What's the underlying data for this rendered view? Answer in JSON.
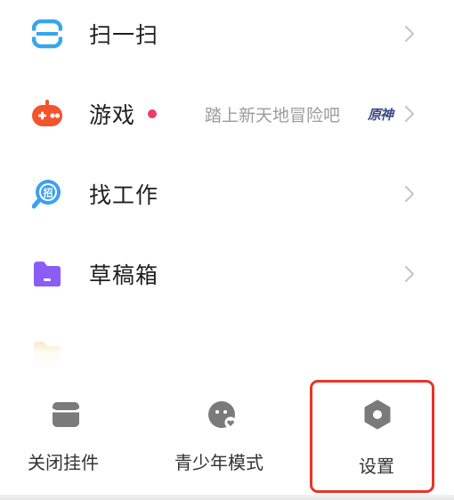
{
  "menu": {
    "items": [
      {
        "label": "扫一扫",
        "icon": "scan-icon"
      },
      {
        "label": "游戏",
        "icon": "gamepad-icon",
        "subtitle": "踏上新天地冒险吧",
        "badge": "原神",
        "has_dot": true
      },
      {
        "label": "找工作",
        "icon": "job-search-icon"
      },
      {
        "label": "草稿箱",
        "icon": "folder-icon"
      },
      {
        "label": "",
        "icon": "folder-icon",
        "partially_visible": true
      }
    ]
  },
  "bottom_bar": {
    "close_widget": {
      "label": "关闭挂件",
      "icon": "widget-icon"
    },
    "teen_mode": {
      "label": "青少年模式",
      "icon": "teen-mode-icon"
    },
    "settings": {
      "label": "设置",
      "icon": "settings-icon"
    }
  },
  "colors": {
    "scan_icon": "#35a6ee",
    "game_icon": "#f2542d",
    "job_icon": "#3b9ff5",
    "drafts_icon": "#8b5cf6",
    "partial_icon": "#f3b43a",
    "red_dot": "#ee3b6a",
    "highlight_border": "#e8342a",
    "bottom_icon": "#7a7a7a"
  }
}
